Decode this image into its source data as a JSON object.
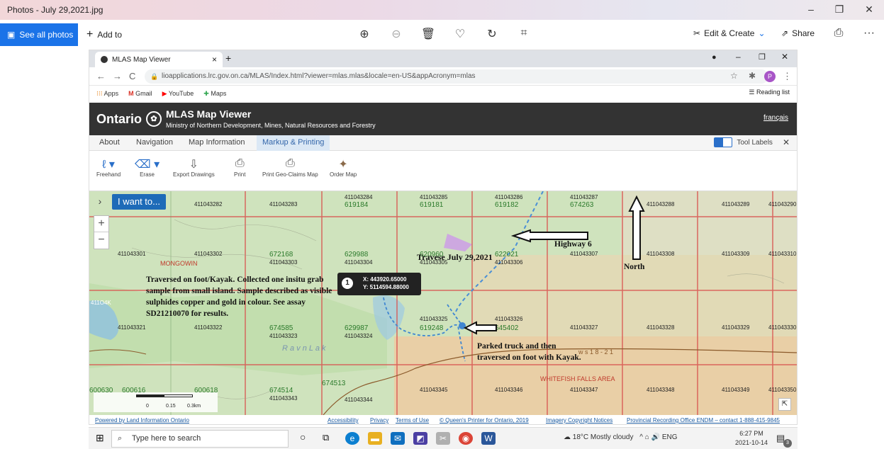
{
  "photos": {
    "title": "Photos - July 29,2021.jpg",
    "see_all": "See all photos",
    "add_to": "Add to",
    "edit_create": "Edit & Create",
    "share": "Share",
    "more": "···"
  },
  "browser": {
    "tab_title": "MLAS Map Viewer",
    "url": "lioapplications.lrc.gov.on.ca/MLAS/Index.html?viewer=mlas.mlas&locale=en-US&appAcronym=mlas",
    "profile_initial": "P",
    "bookmarks": [
      "Apps",
      "Gmail",
      "YouTube",
      "Maps"
    ],
    "reading_list": "Reading list"
  },
  "mlas": {
    "ontario": "Ontario",
    "title": "MLAS Map Viewer",
    "subtitle": "Ministry of Northern Development, Mines, Natural Resources and Forestry",
    "francais": "français",
    "menu": [
      "About",
      "Navigation",
      "Map Information",
      "Markup & Printing"
    ],
    "tool_labels": "Tool Labels",
    "ribbon": [
      "Freehand",
      "Erase",
      "Export Drawings",
      "Print",
      "Print Geo-Claims Map",
      "Order Map"
    ],
    "i_want_to": "I want to..."
  },
  "map": {
    "cells_small": [
      {
        "t": "411043282",
        "k": "a"
      },
      {
        "t": "411043283",
        "k": "b"
      },
      {
        "t": "411043284",
        "k": "c"
      },
      {
        "t": "411043285",
        "k": "d"
      },
      {
        "t": "411043286",
        "k": "e"
      },
      {
        "t": "411043287",
        "k": "f"
      },
      {
        "t": "411043288",
        "k": "g"
      },
      {
        "t": "411043289",
        "k": "h"
      },
      {
        "t": "411043290",
        "k": "i"
      },
      {
        "t": "411043301",
        "k": "j"
      },
      {
        "t": "411043302",
        "k": "k"
      },
      {
        "t": "411043303",
        "k": "l"
      },
      {
        "t": "411043304",
        "k": "m"
      },
      {
        "t": "411043305",
        "k": "n"
      },
      {
        "t": "411043306",
        "k": "o"
      },
      {
        "t": "411043307",
        "k": "p"
      },
      {
        "t": "411043308",
        "k": "q"
      },
      {
        "t": "411043309",
        "k": "r"
      },
      {
        "t": "411043310",
        "k": "s"
      },
      {
        "t": "411043321",
        "k": "t"
      },
      {
        "t": "411043322",
        "k": "u"
      },
      {
        "t": "411043323",
        "k": "v"
      },
      {
        "t": "411043324",
        "k": "w"
      },
      {
        "t": "411043325",
        "k": "x"
      },
      {
        "t": "411043326",
        "k": "y"
      },
      {
        "t": "411043327",
        "k": "z"
      },
      {
        "t": "411043328",
        "k": "aa"
      },
      {
        "t": "411043329",
        "k": "ab"
      },
      {
        "t": "411043330",
        "k": "ac"
      },
      {
        "t": "411043343",
        "k": "ad"
      },
      {
        "t": "411043344",
        "k": "ae"
      },
      {
        "t": "411043345",
        "k": "af"
      },
      {
        "t": "411043346",
        "k": "ag"
      },
      {
        "t": "411043347",
        "k": "ah"
      },
      {
        "t": "411043348",
        "k": "ai"
      },
      {
        "t": "411043349",
        "k": "aj"
      },
      {
        "t": "411043350",
        "k": "ak"
      }
    ],
    "claims": [
      "619184",
      "619181",
      "619182",
      "674263",
      "672168",
      "629988",
      "620960",
      "622021",
      "674585",
      "629987",
      "619248",
      "645402",
      "674514",
      "674513",
      "600630",
      "600616",
      "600618"
    ],
    "place_labels": [
      "MONGOWIN",
      "WHITEFISH FALLS AREA",
      "w s 1 8 - 2 1",
      "R a v   n   L a k",
      "411O4K"
    ],
    "coord_popup": {
      "num": "1",
      "x": "X: 443920.65000",
      "y": "Y: 5114594.88000"
    },
    "scale": {
      "a": "0",
      "b": "0.15",
      "c": "0.3km"
    }
  },
  "annotations": {
    "note_main": "Traversed on foot/Kayak. Collected one insitu grab sample from small island. Sample described as visible sulphides copper and gold in colour. See assay SD21210070 for results.",
    "traverse": "Travese July 29,2021",
    "highway": "Highway 6",
    "north": "North",
    "parked": "Parked truck and then traversed on foot with Kayak."
  },
  "footer": {
    "powered": "Powered by Land Information Ontario",
    "links": [
      "Accessibility",
      "Privacy",
      "Terms of Use",
      "© Queen's Printer for Ontario, 2019",
      "Imagery Copyright Notices",
      "Provincial Recording Office ENDM – contact 1-888-415-9845"
    ]
  },
  "taskbar": {
    "search": "Type here to search",
    "weather": "18°C  Mostly cloudy",
    "lang": "ENG",
    "time": "6:27 PM",
    "date": "2021-10-14",
    "badge": "3"
  },
  "colors": {
    "accent": "#1a73e8",
    "claim_line": "#d9534f",
    "claim_green": "#2b7a2b",
    "mlas_header": "#333333"
  }
}
